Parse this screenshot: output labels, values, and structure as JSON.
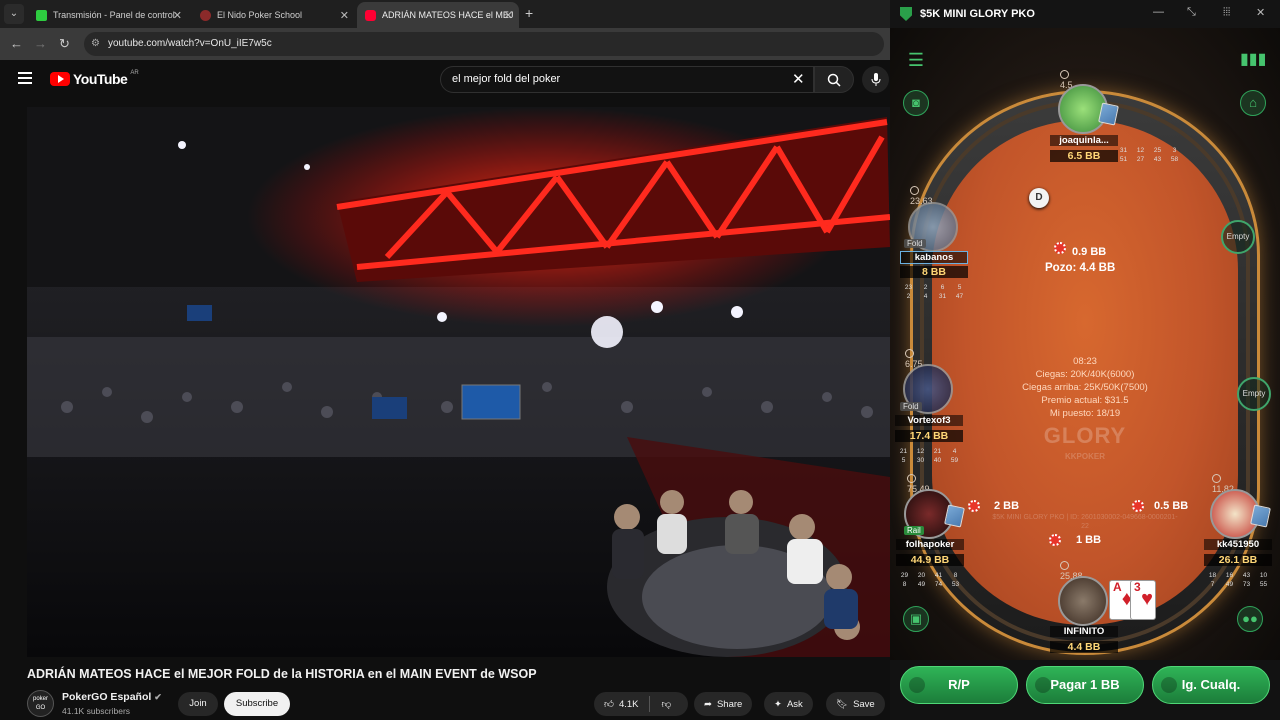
{
  "browser": {
    "tabs": [
      {
        "title": "Transmisión - Panel de control",
        "favicon_color": "#2ecc40"
      },
      {
        "title": "El Nido Poker School",
        "favicon_color": "#8b2a2a"
      },
      {
        "title": "ADRIÁN MATEOS HACE el MEJ",
        "favicon_color": "#ff0033"
      }
    ],
    "url": "youtube.com/watch?v=OnU_iIE7w5c"
  },
  "youtube": {
    "logo_text": "YouTube",
    "region": "AR",
    "search_query": "el mejor fold del poker",
    "video_title": "ADRIÁN MATEOS HACE el MEJOR FOLD de la HISTORIA en el MAIN EVENT de WSOP",
    "channel": {
      "name": "PokerGO Español",
      "subscribers": "41.1K subscribers",
      "avatar_text": "poker GO"
    },
    "join_label": "Join",
    "subscribe_label": "Subscribe",
    "likes": "4.1K",
    "share_label": "Share",
    "ask_label": "Ask",
    "save_label": "Save"
  },
  "poker": {
    "window_title": "$5K MINI GLORY PKO",
    "pot_bet": "0.9 BB",
    "pot_total": "Pozo: 4.4 BB",
    "info": {
      "time": "08:23",
      "blinds": "Ciegas: 20K/40K(6000)",
      "next_blinds": "Ciegas arriba: 25K/50K(7500)",
      "prize": "Premio actual: $31.5",
      "position": "Mi puesto: 18/19"
    },
    "glory_logo": "GLORY",
    "glory_sub": "KKPOKER",
    "watermark": "$5K MINI GLORY PKO | ID: 2601030002-049668-0000201-22",
    "dealer": "D",
    "empty_label": "Empty",
    "seats": [
      {
        "name": "joaquinla...",
        "stack": "6.5 BB",
        "bounty": "4.5",
        "stats": [
          "31",
          "12",
          "25",
          "3",
          "51",
          "27",
          "43",
          "58"
        ]
      },
      {
        "name": "kabanos",
        "stack": "8 BB",
        "bounty": "23.63",
        "stats": [
          "23",
          "2",
          "6",
          "5",
          "2",
          "4",
          "31",
          "47"
        ],
        "tag": "Fold"
      },
      {
        "name": "Vortexof3",
        "stack": "17.4 BB",
        "bounty": "6.75",
        "stats": [
          "21",
          "12",
          "21",
          "4",
          "5",
          "30",
          "40",
          "59"
        ],
        "tag": "Fold"
      },
      {
        "name": "folhapoker",
        "stack": "44.9 BB",
        "bounty": "75.49",
        "stats": [
          "29",
          "20",
          "41",
          "8",
          "8",
          "49",
          "74",
          "53"
        ],
        "tag": "Rail"
      },
      {
        "name": "INFINITO",
        "stack": "4.4 BB",
        "bounty": "25.88"
      },
      {
        "name": "kk451950",
        "stack": "26.1 BB",
        "bounty": "11.82",
        "stats": [
          "18",
          "16",
          "43",
          "10",
          "7",
          "49",
          "73",
          "55"
        ]
      }
    ],
    "bets": {
      "left": "2 BB",
      "right": "0.5 BB",
      "bottom": "1 BB"
    },
    "hole_cards": [
      {
        "rank": "A",
        "suit": "♦"
      },
      {
        "rank": "3",
        "suit": "♥"
      }
    ],
    "actions": [
      "R/P",
      "Pagar 1 BB",
      "Ig. Cualq."
    ]
  }
}
